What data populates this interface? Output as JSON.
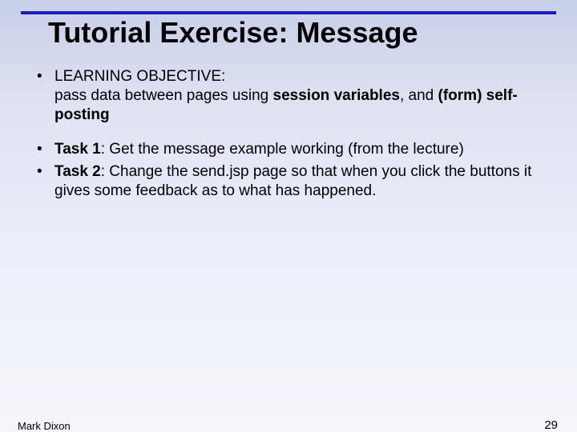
{
  "title": "Tutorial Exercise: Message",
  "objective": {
    "label": "LEARNING OBJECTIVE:",
    "prefix": "pass data between pages using ",
    "bold1": "session variables",
    "mid": ", and ",
    "bold2": "(form) self-posting"
  },
  "tasks": [
    {
      "label": "Task 1",
      "text": ": Get the message example working (from the lecture)"
    },
    {
      "label": "Task 2",
      "text": ": Change the send.jsp page so that when you click the buttons it gives some feedback as to what has happened."
    }
  ],
  "footer": {
    "author": "Mark Dixon",
    "page": "29"
  }
}
